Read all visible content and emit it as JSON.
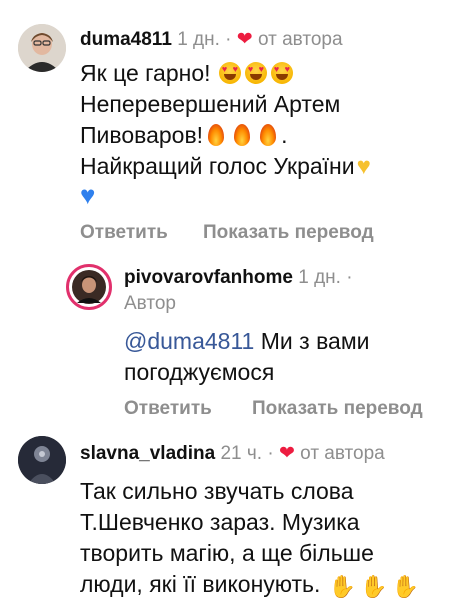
{
  "comments": [
    {
      "username": "duma4811",
      "time": "1 дн. ·",
      "liked_by_author_label": "от автора",
      "lines": [
        "Як це гарно!",
        "Неперевершений Артем",
        "Пивоваров!",
        ".",
        "Найкращий голос України"
      ],
      "actions": {
        "reply": "Ответить",
        "translate": "Показать перевод"
      },
      "replies": [
        {
          "username": "pivovarovfanhome",
          "time": "1 дн. ·",
          "author_badge": "Автор",
          "mention": "@duma4811",
          "lines": [
            "Ми з вами",
            "погоджуємося"
          ],
          "actions": {
            "reply": "Ответить",
            "translate": "Показать перевод"
          }
        }
      ]
    },
    {
      "username": "slavna_vladina",
      "time": "21 ч. ·",
      "liked_by_author_label": "от автора",
      "lines": [
        "Так сильно звучать слова",
        "Т.Шевченко зараз. Музика",
        "творить магію, а ще більше",
        "люди, які її виконують."
      ]
    }
  ],
  "icons": {
    "heart": "heart-icon",
    "heart_eyes": "heart-eyes-emoji",
    "fire": "fire-emoji",
    "yellow_heart": "yellow-heart-emoji",
    "blue_heart": "blue-heart-emoji",
    "clap": "clapping-hands-emoji"
  },
  "colors": {
    "heart": "#ed1c40",
    "mention": "#385898",
    "muted": "#8e8e8e",
    "yellow_heart": "#f6c12f",
    "blue_heart": "#2f80ed"
  }
}
